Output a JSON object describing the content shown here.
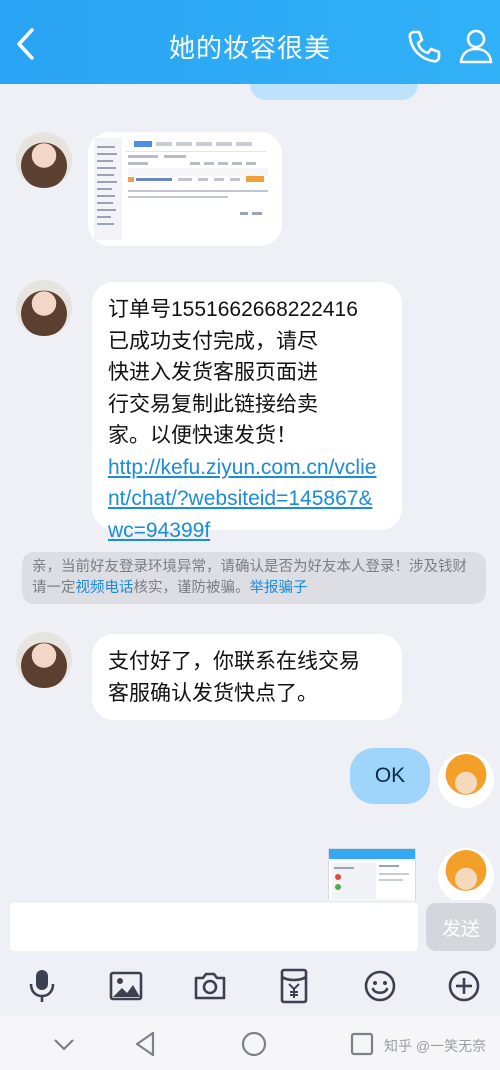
{
  "header": {
    "title": "她的妆容很美"
  },
  "messages": {
    "order_text_lines": [
      "订单号1551662668222416",
      "已成功支付完成，请尽",
      "快进入发货客服页面进",
      "行交易复制此链接给卖",
      "家。以便快速发货！"
    ],
    "order_link": "http://kefu.ziyun.com.cn/vclient/chat/?websiteid=145867&wc=94399f",
    "paid_text_lines": [
      "支付好了，你联系在线交易",
      "客服确认发货快点了。"
    ],
    "ok_text": "OK"
  },
  "notice": {
    "text_part1": "亲，当前好友登录环境异常，请确认是否为好友本人登录！涉及钱财请一定",
    "link1": "视频电话",
    "text_part2": "核实，谨防被骗。",
    "link2": "举报骗子"
  },
  "input": {
    "placeholder": "",
    "send_label": "发送"
  },
  "toolbar": {
    "icons": [
      "microphone-icon",
      "image-icon",
      "camera-icon",
      "red-packet-icon",
      "emoji-icon",
      "plus-icon"
    ]
  },
  "navbar": {
    "watermark": "知乎 @一笑无奈"
  },
  "colors": {
    "header": "#2aa4f4",
    "link": "#1a8cd8",
    "ok_bubble": "#9fd4fb"
  }
}
